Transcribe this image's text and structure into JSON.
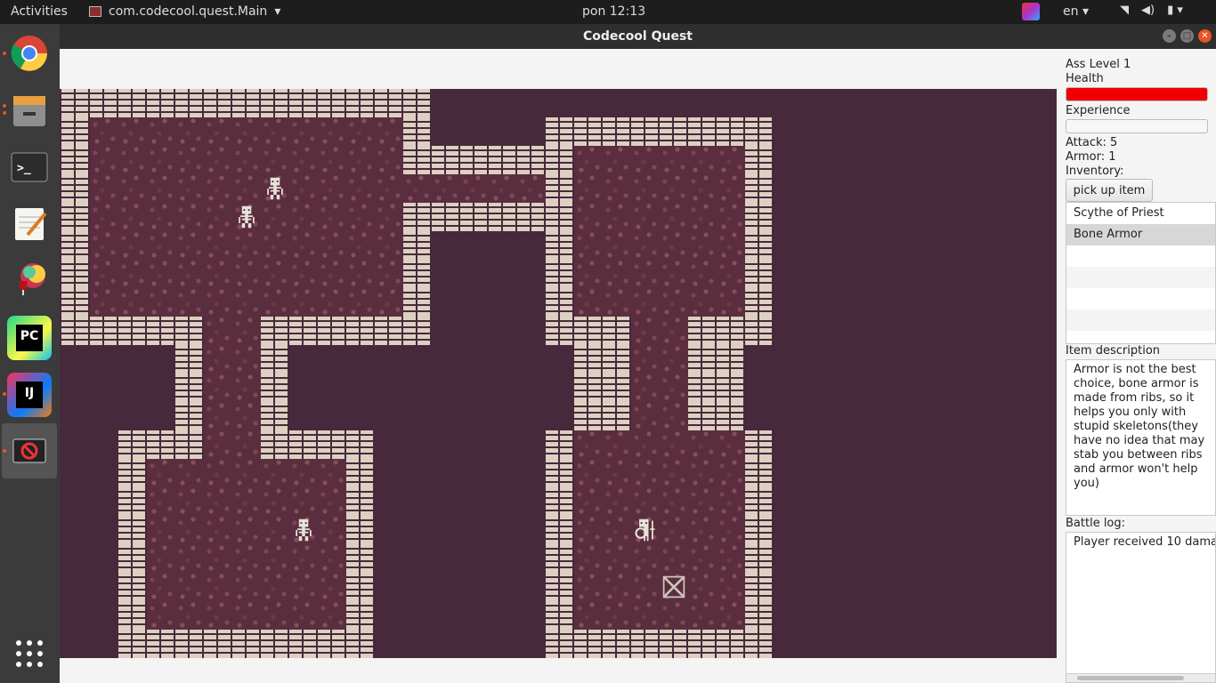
{
  "system": {
    "activities": "Activities",
    "app_menu": "com.codecool.quest.Main",
    "clock": "pon 12:13",
    "language": "en"
  },
  "window": {
    "title": "Codecool Quest"
  },
  "dock": {
    "items": [
      "chrome-icon",
      "files-icon",
      "terminal-icon",
      "text-editor-icon",
      "wine-icon",
      "pycharm-icon",
      "intellij-icon",
      "java-app-icon"
    ]
  },
  "panel": {
    "level": "Ass Level 1",
    "health_label": "Health",
    "health_fraction": 1.0,
    "health_color": "#f00000",
    "experience_label": "Experience",
    "experience_fraction": 0.0,
    "attack": "Attack: 5",
    "armor": "Armor: 1",
    "inventory_label": "Inventory:",
    "pick_up_label": "pick up item",
    "inventory": [
      "Scythe of Priest",
      "Bone Armor"
    ],
    "selected_item": 1,
    "item_description_label": "Item description",
    "item_description": "Armor is not the best choice, bone armor is made from ribs, so it helps you only with stupid skeletons(they have no idea that may stab you between ribs and armor won't help you)",
    "battle_log_label": "Battle log:",
    "battle_log": "Player received 10 dama"
  },
  "colors": {
    "map_background": "#47293b",
    "floor": "#5a2e3f",
    "wall": "#ddd0c2",
    "topbar": "#1d1d1d",
    "dock": "#3b3b3b"
  }
}
